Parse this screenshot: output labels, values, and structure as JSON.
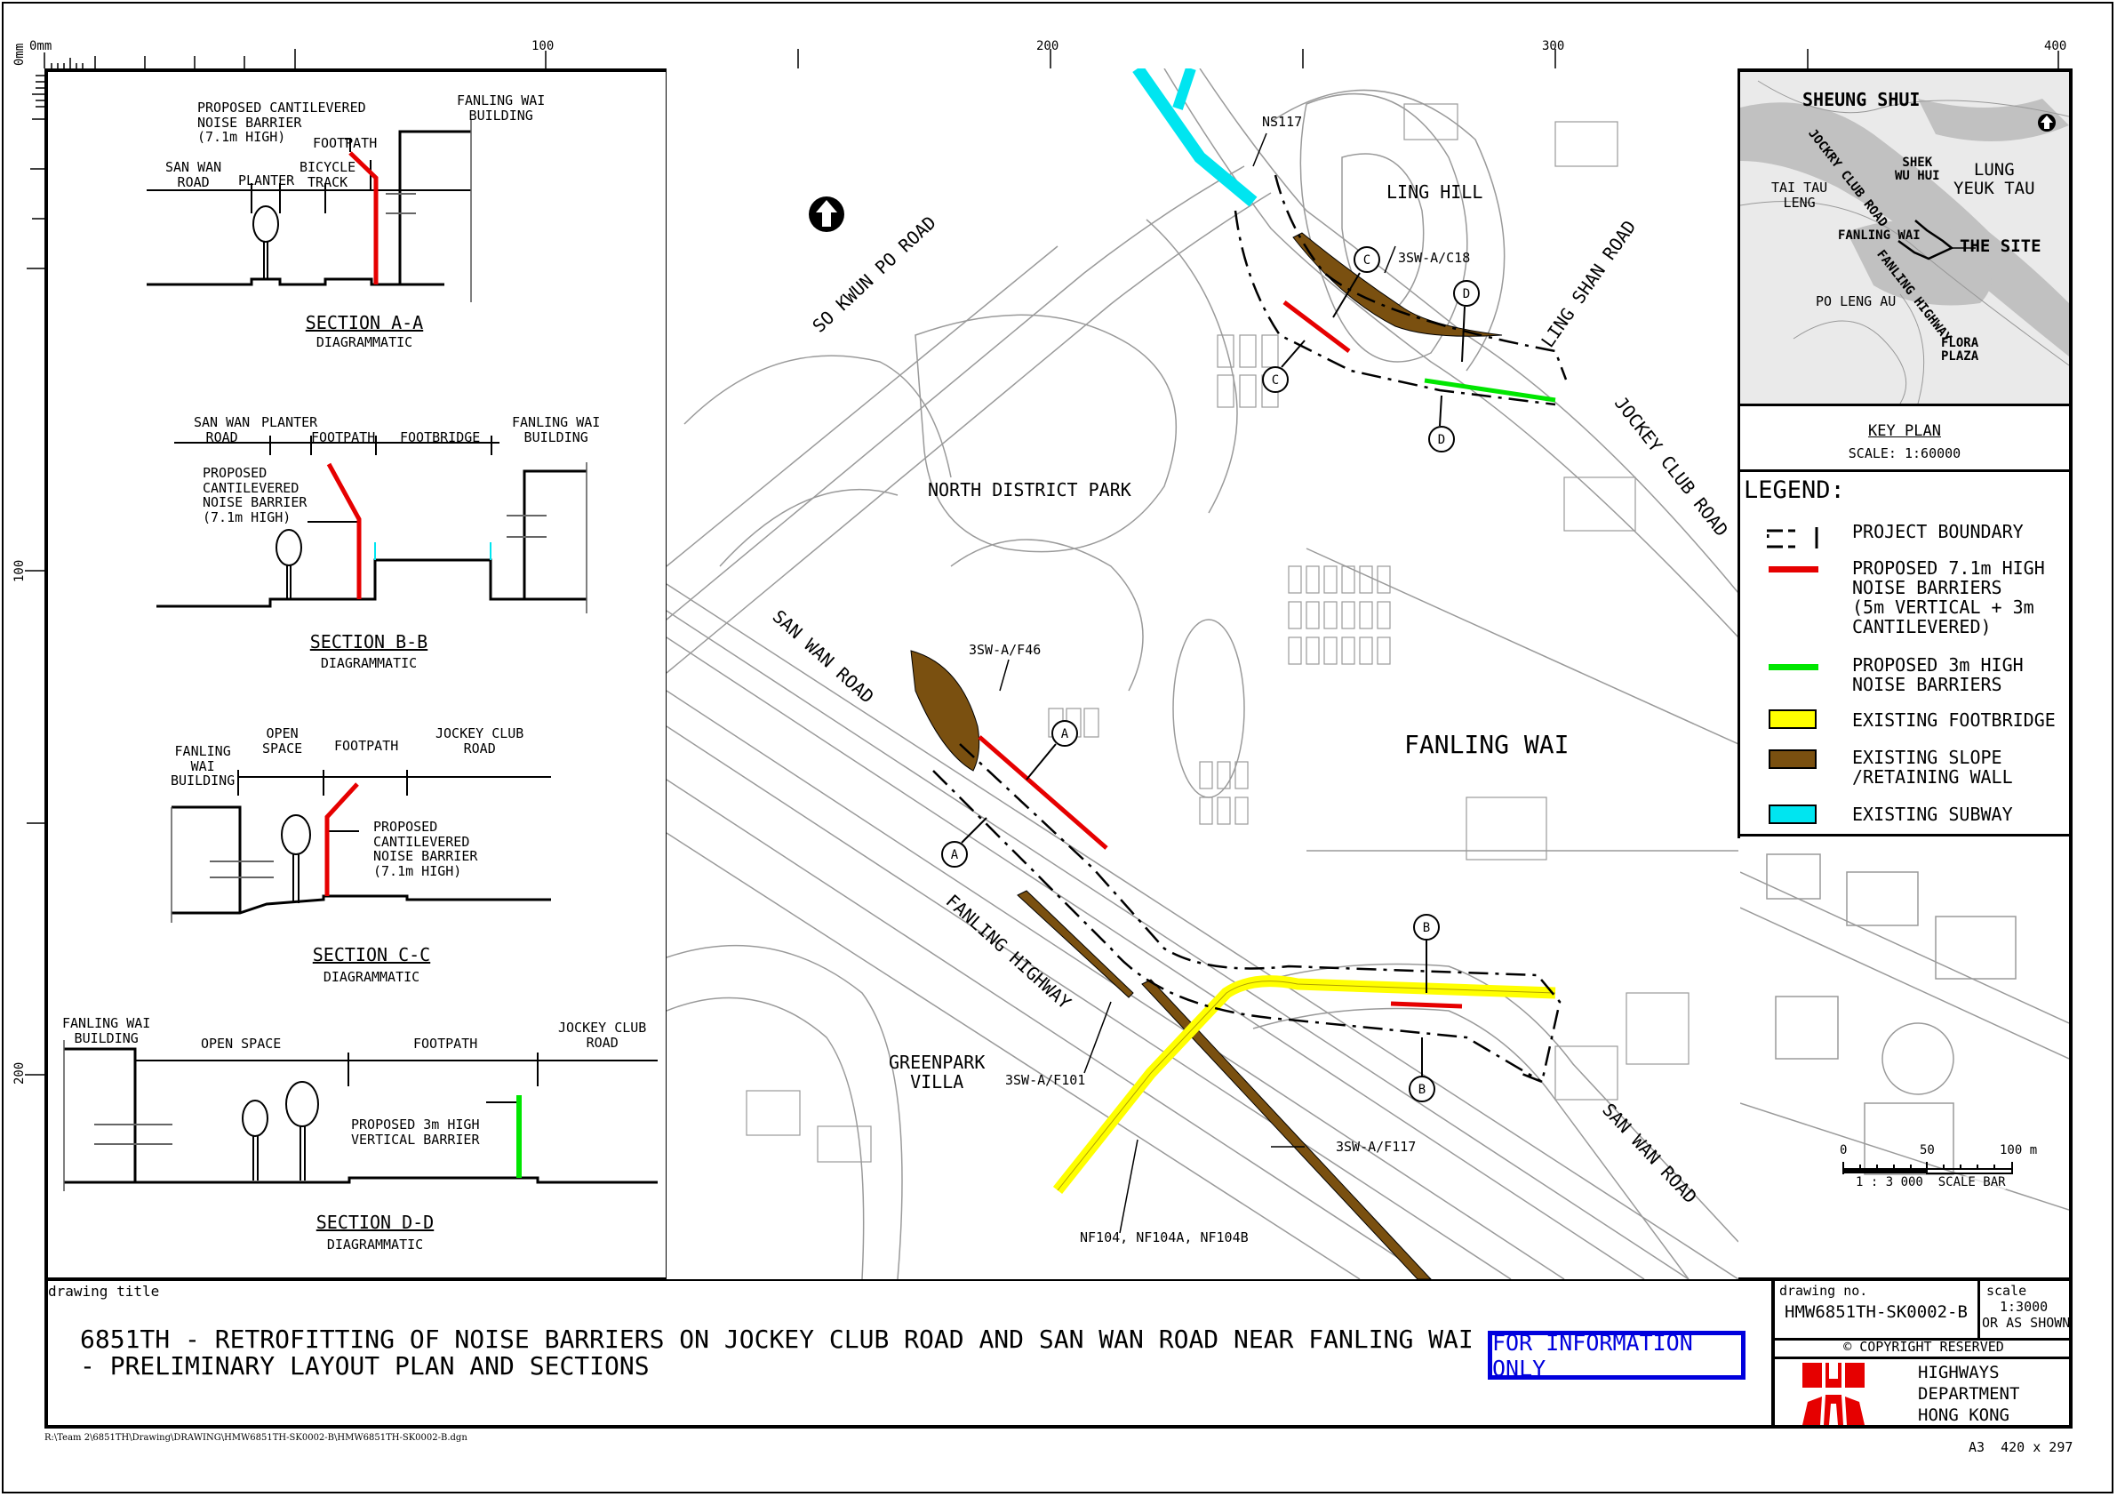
{
  "sheet": {
    "size_label": "A3  420 x 297",
    "file_path": "R:\\Team 2\\6851TH\\Drawing\\DRAWING\\HMW6851TH-SK0002-B\\HMW6851TH-SK0002-B.dgn"
  },
  "rulers": {
    "top": [
      "0mm",
      "100",
      "200",
      "300",
      "400"
    ],
    "left": [
      "0mm",
      "100",
      "200"
    ]
  },
  "sections": [
    {
      "id": "A-A",
      "title": "SECTION A-A",
      "subtitle": "DIAGRAMMATIC",
      "labels": {
        "road": "SAN WAN\nROAD",
        "planter": "PLANTER",
        "bicycle": "BICYCLE\nTRACK",
        "footpath": "FOOTPATH",
        "building": "FANLING WAI\nBUILDING",
        "barrier": "PROPOSED CANTILEVERED\nNOISE BARRIER\n(7.1m HIGH)"
      }
    },
    {
      "id": "B-B",
      "title": "SECTION B-B",
      "subtitle": "DIAGRAMMATIC",
      "labels": {
        "road": "SAN WAN\nROAD",
        "planter": "PLANTER",
        "footpath": "FOOTPATH",
        "footbridge": "FOOTBRIDGE",
        "building": "FANLING WAI\nBUILDING",
        "barrier": "PROPOSED\nCANTILEVERED\nNOISE BARRIER\n(7.1m HIGH)"
      }
    },
    {
      "id": "C-C",
      "title": "SECTION C-C",
      "subtitle": "DIAGRAMMATIC",
      "labels": {
        "building": "FANLING\nWAI\nBUILDING",
        "open_space": "OPEN\nSPACE",
        "footpath": "FOOTPATH",
        "road": "JOCKEY CLUB\nROAD",
        "barrier": "PROPOSED\nCANTILEVERED\nNOISE BARRIER\n(7.1m HIGH)"
      }
    },
    {
      "id": "D-D",
      "title": "SECTION D-D",
      "subtitle": "DIAGRAMMATIC",
      "labels": {
        "building": "FANLING WAI\nBUILDING",
        "open_space": "OPEN SPACE",
        "footpath": "FOOTPATH",
        "road": "JOCKEY CLUB\nROAD",
        "barrier": "PROPOSED 3m HIGH\nVERTICAL BARRIER"
      }
    }
  ],
  "map": {
    "labels": {
      "so_kwun_po_road": "SO KWUN PO ROAD",
      "north_district_park": "NORTH DISTRICT PARK",
      "ling_hill": "LING HILL",
      "ling_shan_road": "LING SHAN ROAD",
      "jockey_club_road": "JOCKEY CLUB ROAD",
      "san_wan_road_upper": "SAN WAN ROAD",
      "san_wan_road_lower": "SAN WAN ROAD",
      "fanling_highway": "FANLING HIGHWAY",
      "fanling_wai": "FANLING WAI",
      "greenpark_villa": "GREENPARK\nVILLA"
    },
    "callouts": {
      "ns117": "NS117",
      "c18": "3SW-A/C18",
      "f46": "3SW-A/F46",
      "f101": "3SW-A/F101",
      "f117": "3SW-A/F117",
      "nf104": "NF104, NF104A, NF104B"
    },
    "section_markers": [
      "A",
      "A",
      "B",
      "B",
      "C",
      "C",
      "D",
      "D"
    ],
    "scale_bar": {
      "ticks": [
        "0",
        "50",
        "100 m"
      ],
      "caption": "1 : 3 000  SCALE BAR"
    }
  },
  "key_plan": {
    "places": {
      "sheung_shui": "SHEUNG SHUI",
      "jockey_club_road": "JOCKRY CLUB ROAD",
      "shek_wu_hui": "SHEK\nWU HUI",
      "lung_yeuk_tau": "LUNG\nYEUK TAU",
      "tai_tau_leng": "TAI TAU\nLENG",
      "fanling_wai": "FANLING WAI",
      "the_site": "THE SITE",
      "fanling_highway": "FANLING HIGHWAY",
      "po_leng_au": "PO LENG AU",
      "flora_plaza": "FLORA\nPLAZA"
    },
    "title": "KEY PLAN",
    "scale": "SCALE: 1:60000"
  },
  "legend": {
    "title": "LEGEND:",
    "items": [
      {
        "label": "PROJECT BOUNDARY",
        "symbol": "dash-dot-line",
        "color": "#000000"
      },
      {
        "label": "PROPOSED 7.1m HIGH\nNOISE BARRIERS\n(5m VERTICAL + 3m\nCANTILEVERED)",
        "symbol": "line",
        "color": "#e60000"
      },
      {
        "label": "PROPOSED 3m HIGH\nNOISE BARRIERS",
        "symbol": "line",
        "color": "#00e600"
      },
      {
        "label": "EXISTING FOOTBRIDGE",
        "symbol": "box",
        "color": "#ffff00"
      },
      {
        "label": "EXISTING SLOPE\n/RETAINING WALL",
        "symbol": "box",
        "color": "#7a5010"
      },
      {
        "label": "EXISTING SUBWAY",
        "symbol": "box",
        "color": "#00e5f0"
      }
    ]
  },
  "title_block": {
    "drawing_title_label": "drawing title",
    "title_line1": "6851TH - RETROFITTING OF NOISE BARRIERS ON JOCKEY CLUB ROAD AND SAN WAN ROAD NEAR FANLING WAI",
    "title_line2": "- PRELIMINARY LAYOUT PLAN AND SECTIONS",
    "stamp": "FOR INFORMATION ONLY",
    "drawing_no_label": "drawing no.",
    "drawing_no": "HMW6851TH-SK0002-B",
    "scale_label": "scale",
    "scale_value": "1:3000",
    "scale_note": "OR AS SHOWN",
    "copyright": "© COPYRIGHT RESERVED",
    "department": "HIGHWAYS\nDEPARTMENT\nHONG KONG"
  },
  "colors": {
    "noise_barrier_7m": "#e60000",
    "noise_barrier_3m": "#00e600",
    "footbridge": "#ffff00",
    "slope": "#7a5010",
    "subway": "#00e5f0",
    "stamp": "#0000dd",
    "map_lines": "#9a9a9a"
  }
}
